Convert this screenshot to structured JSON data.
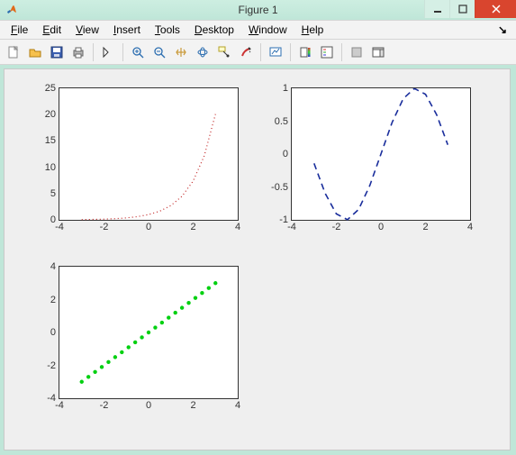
{
  "window": {
    "title": "Figure 1"
  },
  "menu": {
    "file": "File",
    "edit": "Edit",
    "view": "View",
    "insert": "Insert",
    "tools": "Tools",
    "desktop": "Desktop",
    "window": "Window",
    "help": "Help"
  },
  "chart_data": [
    {
      "type": "line",
      "style": "dotted",
      "color": "#c02020",
      "x": [
        -3,
        -2.5,
        -2,
        -1.5,
        -1,
        -0.5,
        0,
        0.5,
        1,
        1.5,
        2,
        2.5,
        3
      ],
      "y": [
        0.0498,
        0.0821,
        0.1353,
        0.2231,
        0.3679,
        0.6065,
        1,
        1.6487,
        2.7183,
        4.4817,
        7.3891,
        12.1825,
        20.0855
      ],
      "xlabel": "",
      "ylabel": "",
      "xlim": [
        -4,
        4
      ],
      "ylim": [
        0,
        25
      ],
      "xticks": [
        -4,
        -2,
        0,
        2,
        4
      ],
      "yticks": [
        0,
        5,
        10,
        15,
        20,
        25
      ]
    },
    {
      "type": "line",
      "style": "dashed",
      "color": "#1a2e9c",
      "x": [
        -3,
        -2.5,
        -2,
        -1.5,
        -1,
        -0.5,
        0,
        0.5,
        1,
        1.5,
        2,
        2.5,
        3
      ],
      "y": [
        -0.1411,
        -0.5985,
        -0.9093,
        -0.9975,
        -0.8415,
        -0.4794,
        0,
        0.4794,
        0.8415,
        0.9975,
        0.9093,
        0.5985,
        0.1411
      ],
      "xlabel": "",
      "ylabel": "",
      "xlim": [
        -4,
        4
      ],
      "ylim": [
        -1,
        1
      ],
      "xticks": [
        -4,
        -2,
        0,
        2,
        4
      ],
      "yticks": [
        -1,
        -0.5,
        0,
        0.5,
        1
      ]
    },
    {
      "type": "scatter",
      "style": "dots",
      "color": "#00d010",
      "x": [
        -3,
        -2.7,
        -2.4,
        -2.1,
        -1.8,
        -1.5,
        -1.2,
        -0.9,
        -0.6,
        -0.3,
        0,
        0.3,
        0.6,
        0.9,
        1.2,
        1.5,
        1.8,
        2.1,
        2.4,
        2.7,
        3
      ],
      "y": [
        -3,
        -2.7,
        -2.4,
        -2.1,
        -1.8,
        -1.5,
        -1.2,
        -0.9,
        -0.6,
        -0.3,
        0,
        0.3,
        0.6,
        0.9,
        1.2,
        1.5,
        1.8,
        2.1,
        2.4,
        2.7,
        3
      ],
      "xlabel": "",
      "ylabel": "",
      "xlim": [
        -4,
        4
      ],
      "ylim": [
        -4,
        4
      ],
      "xticks": [
        -4,
        -2,
        0,
        2,
        4
      ],
      "yticks": [
        -4,
        -2,
        0,
        2,
        4
      ]
    }
  ]
}
